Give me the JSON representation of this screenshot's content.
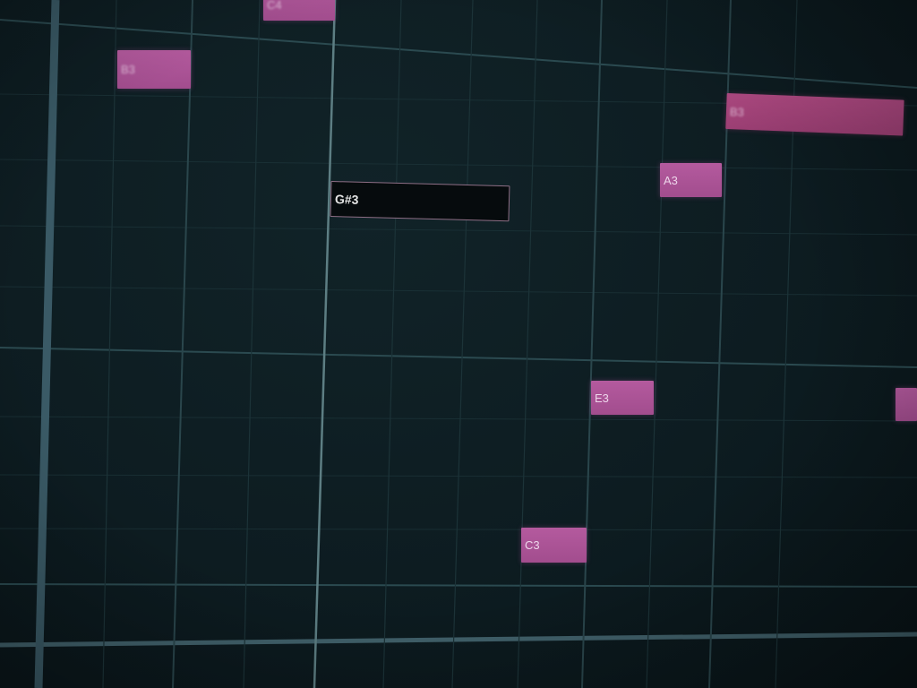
{
  "piano_roll": {
    "notes": [
      {
        "id": "c4-top",
        "label": "C4"
      },
      {
        "id": "b3-left",
        "label": "B3"
      },
      {
        "id": "b3-right",
        "label": "B3"
      },
      {
        "id": "a3",
        "label": "A3"
      },
      {
        "id": "g-sharp-3",
        "label": "G#3"
      },
      {
        "id": "e3",
        "label": "E3"
      },
      {
        "id": "c3",
        "label": "C3"
      },
      {
        "id": "edge-note",
        "label": ""
      }
    ],
    "selected_note": "G#3"
  },
  "colors": {
    "background": "#0d1c21",
    "note_fill": "#b45a9e",
    "note_fill_dark": "#9c3f74",
    "selected_note_border": "#8e6f86",
    "grid_line": "#3a5a5f"
  }
}
